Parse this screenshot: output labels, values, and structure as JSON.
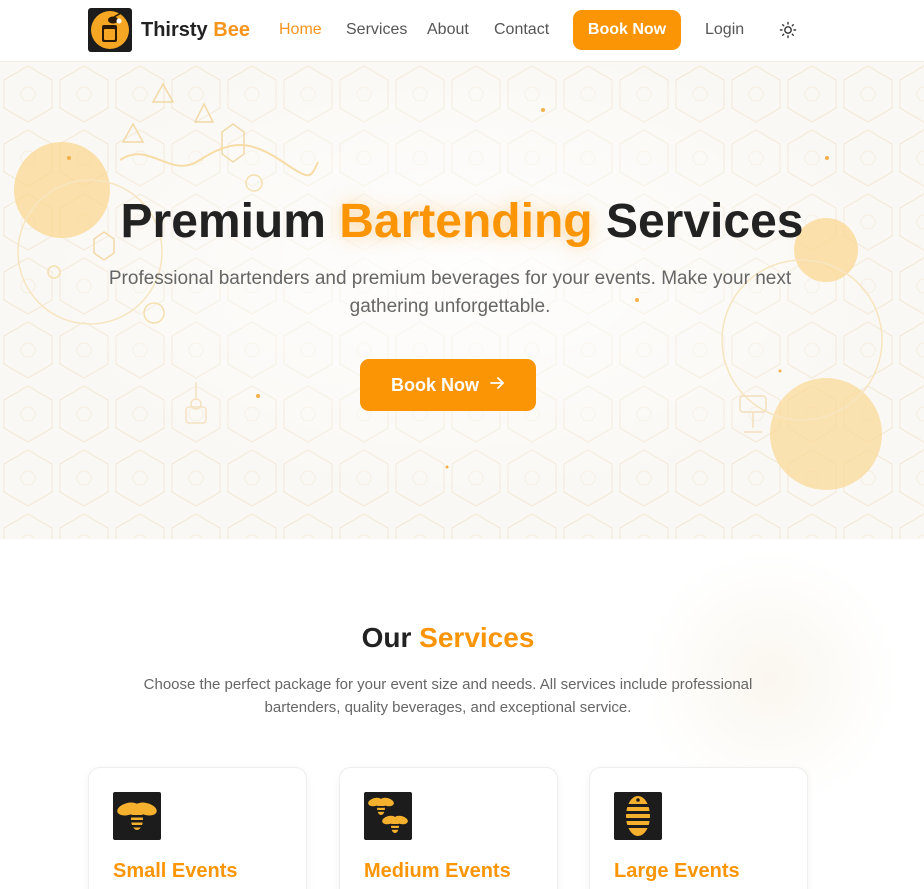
{
  "nav": {
    "brand_main": "Thirsty",
    "brand_accent": "Bee",
    "links": {
      "home": "Home",
      "services": "Services",
      "about": "About",
      "contact": "Contact",
      "login": "Login"
    },
    "book_label": "Book Now",
    "active": "home",
    "theme_icon": "sun-icon"
  },
  "hero": {
    "title_before": "Premium",
    "title_accent": "Bartending",
    "title_after": "Services",
    "subtitle": "Professional bartenders and premium beverages for your events. Make your next gathering unforgettable.",
    "button_label": "Book Now",
    "button_icon": "arrow-right-icon"
  },
  "services": {
    "title_before": "Our",
    "title_accent": "Services",
    "description": "Choose the perfect package for your event size and needs. All services include professional bartenders, quality beverages, and exceptional service.",
    "cards": [
      {
        "title": "Small Events",
        "icon": "single-bee-icon"
      },
      {
        "title": "Medium Events",
        "icon": "two-bees-icon"
      },
      {
        "title": "Large Events",
        "icon": "beehive-icon"
      }
    ]
  },
  "colors": {
    "accent": "#fb9505",
    "text_dark": "#222222",
    "text_muted": "#666666",
    "hero_bg": "#faf8f4"
  }
}
